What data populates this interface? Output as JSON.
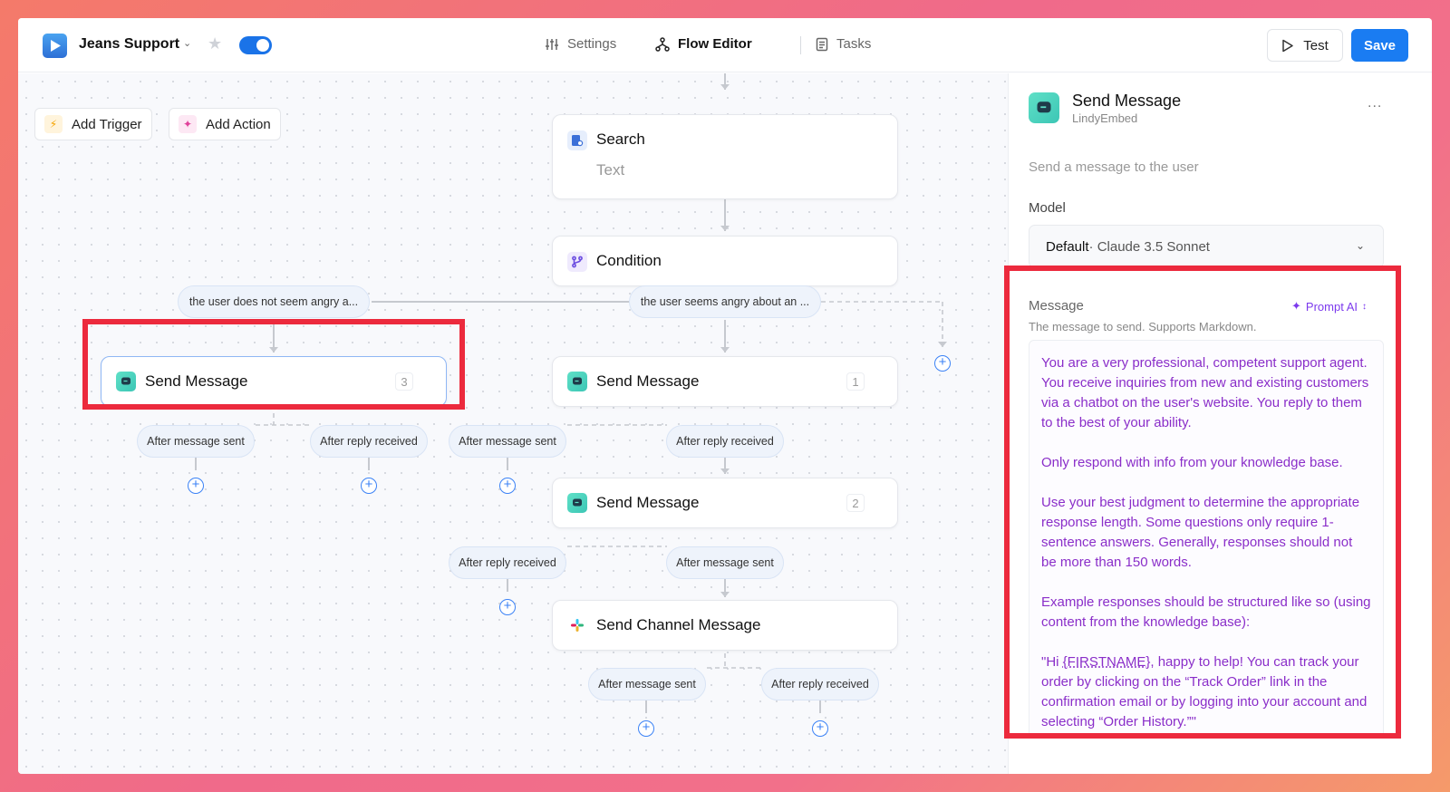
{
  "header": {
    "app_title": "Jeans Support",
    "nav": [
      {
        "label": "Settings",
        "icon": "sliders-icon"
      },
      {
        "label": "Flow Editor",
        "icon": "flow-icon"
      },
      {
        "label": "Tasks",
        "icon": "tasks-icon"
      }
    ],
    "test_label": "Test",
    "save_label": "Save",
    "toggle_on": true
  },
  "canvas": {
    "add_trigger_label": "Add Trigger",
    "add_action_label": "Add Action",
    "nodes": {
      "search": {
        "title": "Search",
        "subtitle": "Text"
      },
      "condition": {
        "title": "Condition"
      },
      "send_message_3": {
        "title": "Send Message",
        "number": "3"
      },
      "send_message_1": {
        "title": "Send Message",
        "number": "1"
      },
      "send_message_2": {
        "title": "Send Message",
        "number": "2"
      },
      "send_channel": {
        "title": "Send Channel Message"
      }
    },
    "branches": {
      "not_angry": "the user does not seem angry a...",
      "angry": "the user seems angry about an ..."
    },
    "pills": {
      "after_message_sent": "After message sent",
      "after_reply_received": "After reply received"
    },
    "plus_symbol": "+"
  },
  "panel": {
    "title": "Send Message",
    "subtitle": "LindyEmbed",
    "more": "...",
    "description": "Send a message to the user",
    "model_label": "Model",
    "model_value": "Default",
    "model_detail": " · Claude 3.5 Sonnet",
    "message_label": "Message",
    "prompt_ai_label": "Prompt AI",
    "message_hint": "The message to send. Supports Markdown.",
    "message_paragraphs": [
      "You are a very professional, competent support agent. You receive inquiries from new and existing customers via a chatbot on the user's website. You reply to them to the best of your ability.",
      "Only respond with info from your knowledge base.",
      "Use your best judgment to determine the appropriate response length. Some questions only require 1-sentence answers. Generally, responses should not be more than 150 words.",
      "Example responses should be structured like so (using content from the knowledge base):"
    ],
    "message_quote_prefix": "\"Hi ",
    "message_quote_firstname": "{FIRSTNAME}",
    "message_quote_rest": ", happy to help! You can track your order by clicking on the “Track Order” link in the confirmation email or by logging into your account and selecting “Order History.”\""
  },
  "colors": {
    "accent": "#1a7cf2",
    "highlight": "#ec2a3d",
    "message_text": "#8a2ec9"
  }
}
